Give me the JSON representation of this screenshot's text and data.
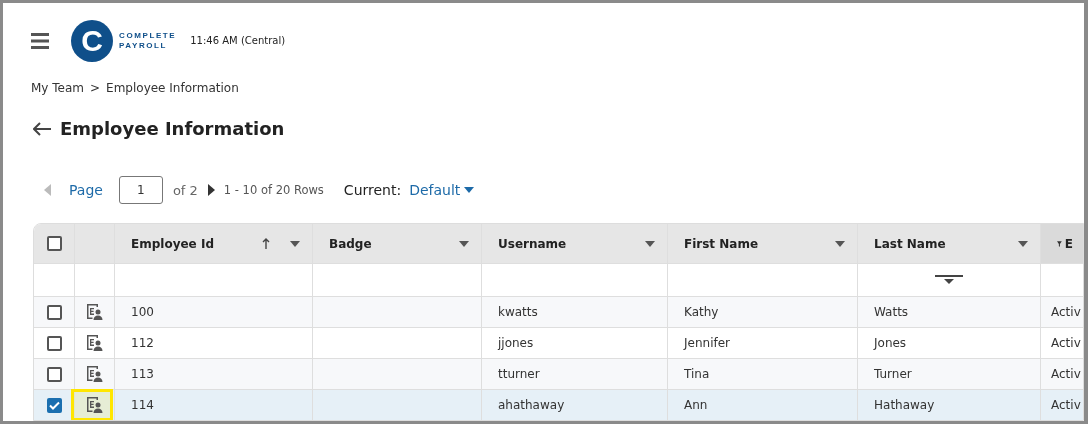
{
  "header": {
    "logo": {
      "mark": "C",
      "lines": [
        "COMPLETE",
        "PAYROLL"
      ]
    },
    "time": "11:46 AM (Central)"
  },
  "breadcrumb": [
    "My Team",
    "Employee Information"
  ],
  "breadcrumb_separator": ">",
  "page_title": "Employee Information",
  "pager": {
    "prev_disabled": true,
    "label": "Page",
    "page": "1",
    "of": "of 2",
    "range": "1 - 10 of 20 Rows",
    "view_label": "Current:",
    "view": "Default"
  },
  "table": {
    "all_checked": false,
    "columns": [
      {
        "label": "Employee Id",
        "sorted": true,
        "filtered": false,
        "filter_row_icon": false
      },
      {
        "label": "Badge",
        "sorted": false,
        "filtered": false,
        "filter_row_icon": false
      },
      {
        "label": "Username",
        "sorted": false,
        "filtered": false,
        "filter_row_icon": false
      },
      {
        "label": "First Name",
        "sorted": false,
        "filtered": false,
        "filter_row_icon": false
      },
      {
        "label": "Last Name",
        "sorted": false,
        "filtered": false,
        "filter_row_icon": true
      },
      {
        "label": "E",
        "sorted": false,
        "filtered": true,
        "filter_row_icon": false
      }
    ],
    "rows": [
      {
        "checked": false,
        "selected": false,
        "highlighted": false,
        "cells": [
          "100",
          "",
          "kwatts",
          "Kathy",
          "Watts",
          "Activ"
        ]
      },
      {
        "checked": false,
        "selected": false,
        "highlighted": false,
        "cells": [
          "112",
          "",
          "jjones",
          "Jennifer",
          "Jones",
          "Activ"
        ]
      },
      {
        "checked": false,
        "selected": false,
        "highlighted": false,
        "cells": [
          "113",
          "",
          "tturner",
          "Tina",
          "Turner",
          "Activ"
        ]
      },
      {
        "checked": true,
        "selected": true,
        "highlighted": true,
        "cells": [
          "114",
          "",
          "ahathaway",
          "Ann",
          "Hathaway",
          "Activ"
        ]
      }
    ]
  }
}
